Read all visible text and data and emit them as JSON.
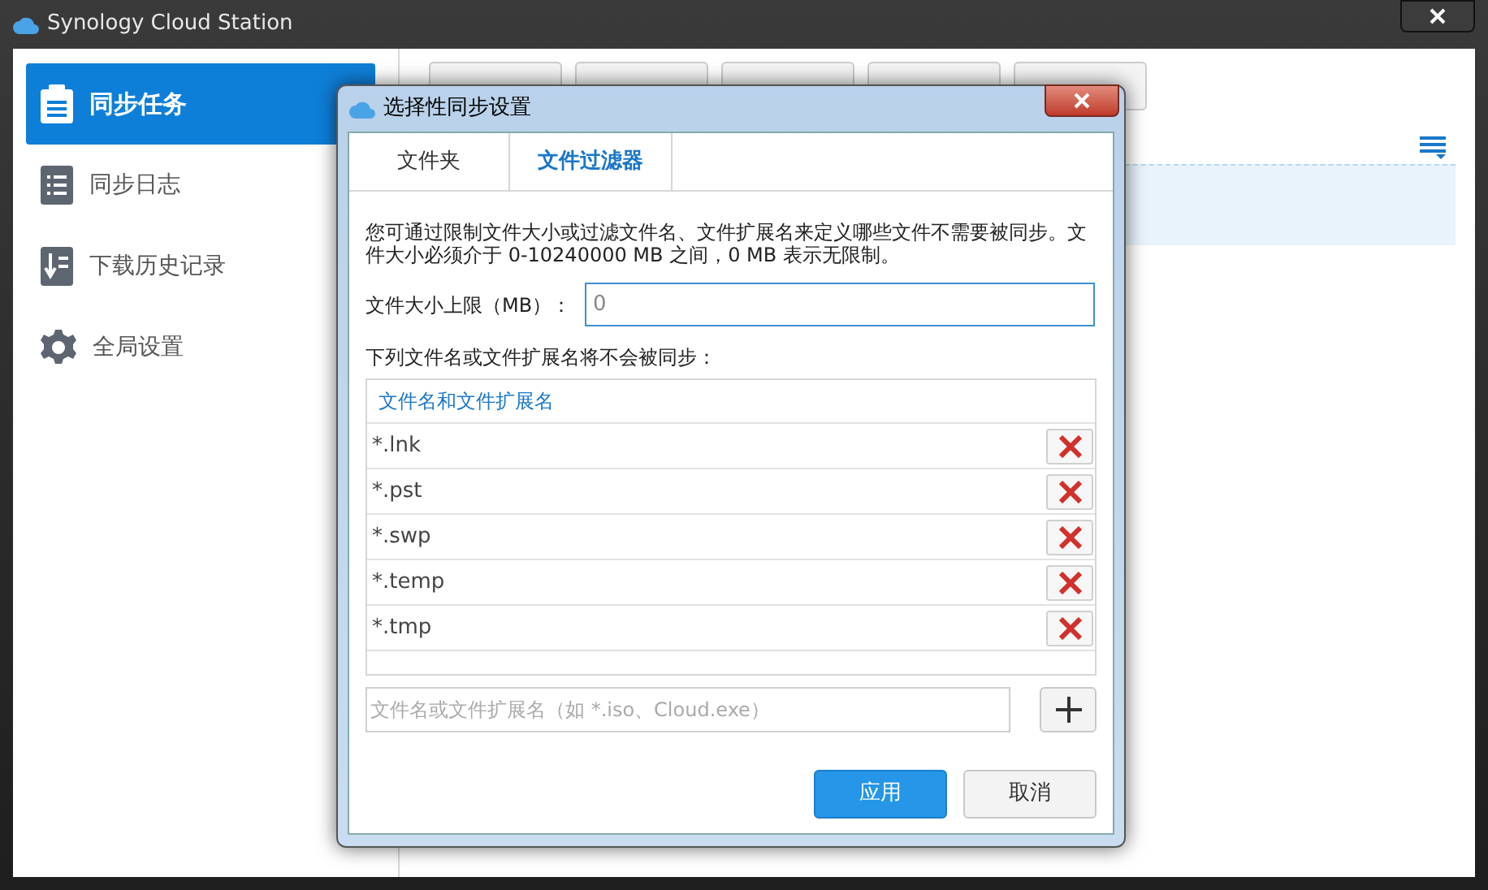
{
  "window": {
    "title": "Synology Cloud Station"
  },
  "sidebar": {
    "items": [
      {
        "label": "同步任务",
        "selected": true
      },
      {
        "label": "同步日志",
        "selected": false
      },
      {
        "label": "下载历史记录",
        "selected": false
      },
      {
        "label": "全局设置",
        "selected": false
      }
    ]
  },
  "dialog": {
    "title": "选择性同步设置",
    "tabs": [
      {
        "label": "文件夹",
        "selected": false
      },
      {
        "label": "文件过滤器",
        "selected": true
      }
    ],
    "description": "您可通过限制文件大小或过滤文件名、文件扩展名来定义哪些文件不需要被同步。文件大小必须介于 0-10240000 MB 之间，0 MB 表示无限制。",
    "size_limit": {
      "label": "文件大小上限（MB）：",
      "value": "0"
    },
    "list_label": "下列文件名或文件扩展名将不会被同步：",
    "table": {
      "column": "文件名和文件扩展名",
      "rows": [
        "*.lnk",
        "*.pst",
        "*.swp",
        "*.temp",
        "*.tmp"
      ]
    },
    "new_entry": {
      "placeholder": "文件名或文件扩展名（如 *.iso、Cloud.exe）"
    },
    "buttons": [
      {
        "label": "应用",
        "kind": "primary"
      },
      {
        "label": "取消",
        "kind": "secondary"
      }
    ]
  }
}
